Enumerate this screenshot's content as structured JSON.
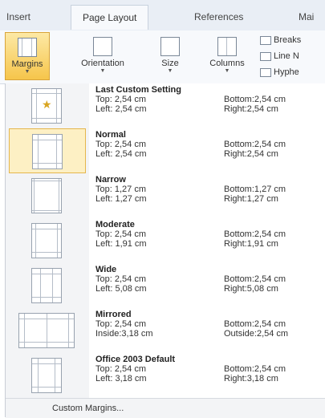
{
  "ribbon_tabs": [
    "Insert",
    "Page Layout",
    "References",
    "Mai"
  ],
  "ribbon_buttons": {
    "margins": "Margins",
    "orientation": "Orientation",
    "size": "Size",
    "columns": "Columns"
  },
  "ribbon_side": [
    "Breaks",
    "Line N",
    "Hyphe"
  ],
  "margins_menu": [
    {
      "name": "Last Custom Setting",
      "l1": "Top:   2,54 cm",
      "l2": "Left:  2,54 cm",
      "r1": "Bottom:2,54 cm",
      "r2": "Right:2,54 cm",
      "icon": "star-icon"
    },
    {
      "name": "Normal",
      "l1": "Top:   2,54 cm",
      "l2": "Left:  2,54 cm",
      "r1": "Bottom:2,54 cm",
      "r2": "Right:2,54 cm",
      "selected": true
    },
    {
      "name": "Narrow",
      "l1": "Top:   1,27 cm",
      "l2": "Left:  1,27 cm",
      "r1": "Bottom:1,27 cm",
      "r2": "Right:1,27 cm"
    },
    {
      "name": "Moderate",
      "l1": "Top:   2,54 cm",
      "l2": "Left:  1,91 cm",
      "r1": "Bottom:2,54 cm",
      "r2": "Right:1,91 cm"
    },
    {
      "name": "Wide",
      "l1": "Top:   2,54 cm",
      "l2": "Left:  5,08 cm",
      "r1": "Bottom:2,54 cm",
      "r2": "Right:5,08 cm"
    },
    {
      "name": "Mirrored",
      "l1": "Top:   2,54 cm",
      "l2": "Inside:3,18 cm",
      "r1": "Bottom:2,54 cm",
      "r2": "Outside:2,54 cm"
    },
    {
      "name": "Office 2003 Default",
      "l1": "Top:   2,54 cm",
      "l2": "Left:  3,18 cm",
      "r1": "Bottom:2,54 cm",
      "r2": "Right:3,18 cm"
    }
  ],
  "custom_margins": "Custom Margins..."
}
